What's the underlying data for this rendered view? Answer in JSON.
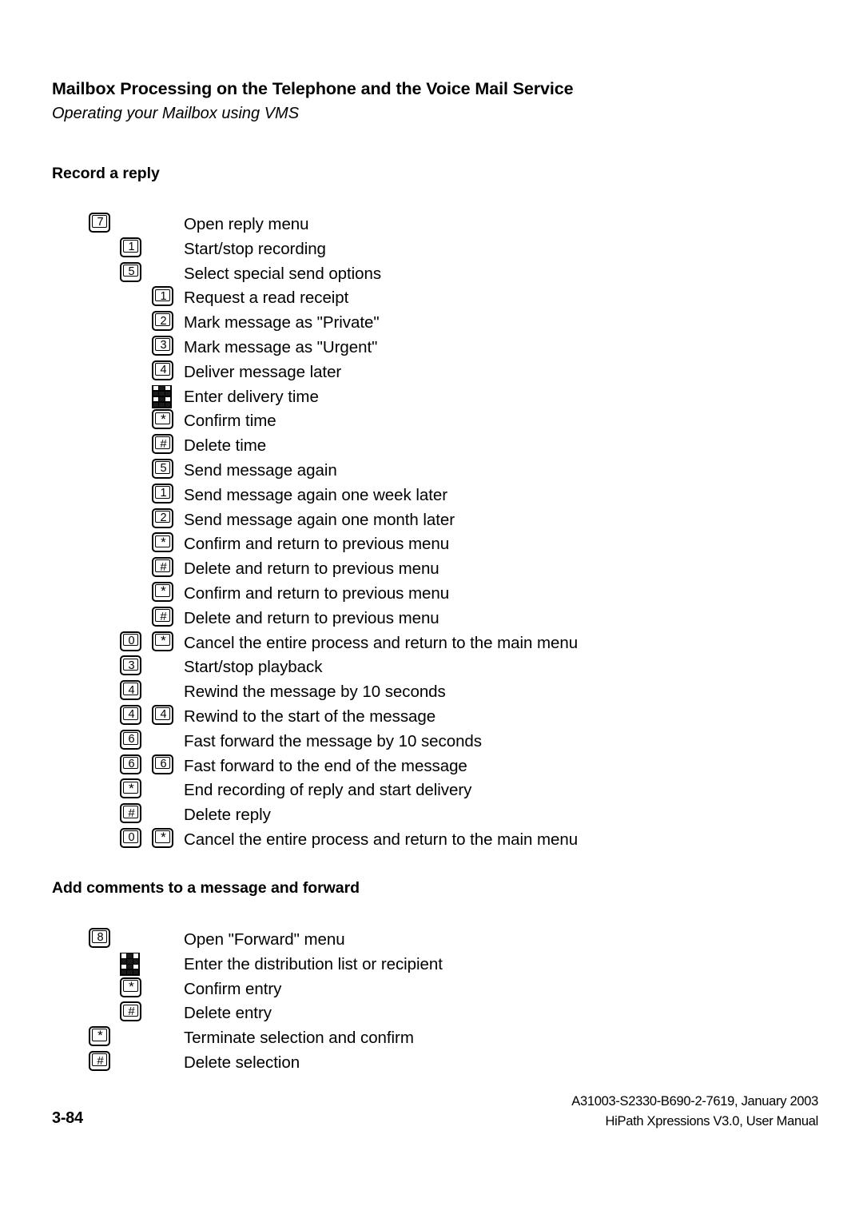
{
  "header": {
    "title": "Mailbox Processing on the Telephone and the Voice Mail Service",
    "subtitle": "Operating your Mailbox using VMS"
  },
  "sections": [
    {
      "heading": "Record a reply",
      "steps": [
        {
          "keys": [
            {
              "type": "digit",
              "value": "7",
              "indent": "a"
            }
          ],
          "label": "Open reply menu"
        },
        {
          "keys": [
            {
              "type": "digit",
              "value": "1",
              "indent": "b"
            }
          ],
          "label": "Start/stop recording"
        },
        {
          "keys": [
            {
              "type": "digit",
              "value": "5",
              "indent": "b"
            }
          ],
          "label": "Select special send options"
        },
        {
          "keys": [
            {
              "type": "digit",
              "value": "1",
              "indent": "c"
            }
          ],
          "label": "Request a read receipt"
        },
        {
          "keys": [
            {
              "type": "digit",
              "value": "2",
              "indent": "c"
            }
          ],
          "label": "Mark message as \"Private\""
        },
        {
          "keys": [
            {
              "type": "digit",
              "value": "3",
              "indent": "c"
            }
          ],
          "label": "Mark message as \"Urgent\""
        },
        {
          "keys": [
            {
              "type": "digit",
              "value": "4",
              "indent": "c"
            }
          ],
          "label": "Deliver message later"
        },
        {
          "keys": [
            {
              "type": "keypad",
              "value": "",
              "indent": "c"
            }
          ],
          "label": "Enter delivery time"
        },
        {
          "keys": [
            {
              "type": "star",
              "value": "*",
              "indent": "c"
            }
          ],
          "label": "Confirm time"
        },
        {
          "keys": [
            {
              "type": "hash",
              "value": "#",
              "indent": "c"
            }
          ],
          "label": "Delete time"
        },
        {
          "keys": [
            {
              "type": "digit",
              "value": "5",
              "indent": "c"
            }
          ],
          "label": "Send message again"
        },
        {
          "keys": [
            {
              "type": "digit",
              "value": "1",
              "indent": "c"
            }
          ],
          "label": "Send message again one week later"
        },
        {
          "keys": [
            {
              "type": "digit",
              "value": "2",
              "indent": "c"
            }
          ],
          "label": "Send message again one month later"
        },
        {
          "keys": [
            {
              "type": "star",
              "value": "*",
              "indent": "c"
            }
          ],
          "label": "Confirm and return to previous menu"
        },
        {
          "keys": [
            {
              "type": "hash",
              "value": "#",
              "indent": "c"
            }
          ],
          "label": "Delete and return to previous menu"
        },
        {
          "keys": [
            {
              "type": "star",
              "value": "*",
              "indent": "c"
            }
          ],
          "label": "Confirm and return to previous menu"
        },
        {
          "keys": [
            {
              "type": "hash",
              "value": "#",
              "indent": "c"
            }
          ],
          "label": "Delete and return to previous menu"
        },
        {
          "keys": [
            {
              "type": "digit",
              "value": "0",
              "indent": "b"
            },
            {
              "type": "star",
              "value": "*",
              "indent": "c"
            }
          ],
          "label": "Cancel the entire process and return to the main menu"
        },
        {
          "keys": [
            {
              "type": "digit",
              "value": "3",
              "indent": "b"
            }
          ],
          "label": "Start/stop playback"
        },
        {
          "keys": [
            {
              "type": "digit",
              "value": "4",
              "indent": "b"
            }
          ],
          "label": "Rewind the message by 10 seconds"
        },
        {
          "keys": [
            {
              "type": "digit",
              "value": "4",
              "indent": "b"
            },
            {
              "type": "digit",
              "value": "4",
              "indent": "c"
            }
          ],
          "label": "Rewind to the start of the message"
        },
        {
          "keys": [
            {
              "type": "digit",
              "value": "6",
              "indent": "b"
            }
          ],
          "label": "Fast forward the message by 10 seconds"
        },
        {
          "keys": [
            {
              "type": "digit",
              "value": "6",
              "indent": "b"
            },
            {
              "type": "digit",
              "value": "6",
              "indent": "c"
            }
          ],
          "label": "Fast forward to the end of the message"
        },
        {
          "keys": [
            {
              "type": "star",
              "value": "*",
              "indent": "b"
            }
          ],
          "label": "End recording of reply and start delivery"
        },
        {
          "keys": [
            {
              "type": "hash",
              "value": "#",
              "indent": "b"
            }
          ],
          "label": "Delete reply"
        },
        {
          "keys": [
            {
              "type": "digit",
              "value": "0",
              "indent": "b"
            },
            {
              "type": "star",
              "value": "*",
              "indent": "c"
            }
          ],
          "label": "Cancel the entire process and return to the main menu"
        }
      ]
    },
    {
      "heading": "Add comments to a message and forward",
      "steps": [
        {
          "keys": [
            {
              "type": "digit",
              "value": "8",
              "indent": "a"
            }
          ],
          "label": "Open \"Forward\" menu"
        },
        {
          "keys": [
            {
              "type": "keypad",
              "value": "",
              "indent": "b"
            }
          ],
          "label": "Enter the distribution list or recipient"
        },
        {
          "keys": [
            {
              "type": "star",
              "value": "*",
              "indent": "b"
            }
          ],
          "label": "Confirm entry"
        },
        {
          "keys": [
            {
              "type": "hash",
              "value": "#",
              "indent": "b"
            }
          ],
          "label": "Delete entry"
        },
        {
          "keys": [
            {
              "type": "star",
              "value": "*",
              "indent": "a"
            }
          ],
          "label": "Terminate selection and confirm"
        },
        {
          "keys": [
            {
              "type": "hash",
              "value": "#",
              "indent": "a"
            }
          ],
          "label": "Delete selection"
        }
      ]
    }
  ],
  "footer": {
    "page_number": "3-84",
    "doc_id": "A31003-S2330-B690-2-7619, January 2003",
    "product": "HiPath Xpressions V3.0, User Manual"
  }
}
